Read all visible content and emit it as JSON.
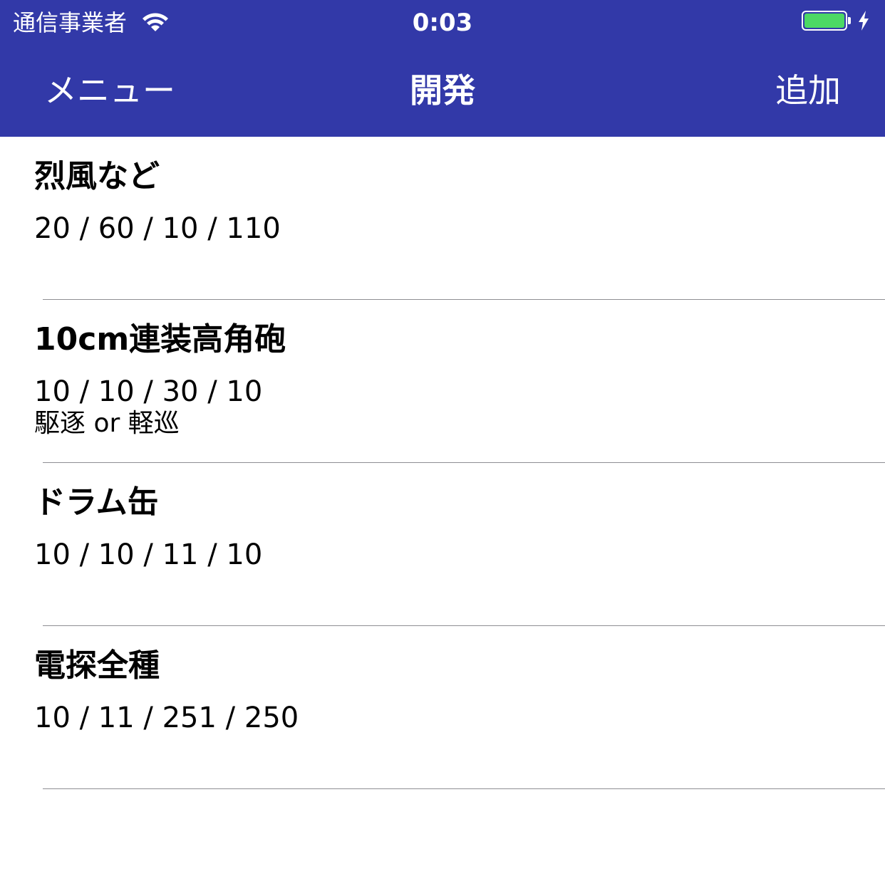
{
  "status_bar": {
    "carrier": "通信事業者",
    "time": "0:03",
    "wifi_icon": "wifi-icon",
    "battery_icon": "battery-icon",
    "charging_icon": "charging-bolt-icon",
    "battery_level": 1.0,
    "battery_color": "#4cd964"
  },
  "navbar": {
    "left_label": "メニュー",
    "title": "開発",
    "right_label": "追加",
    "background_color": "#3239a8"
  },
  "items": [
    {
      "title": "烈風など",
      "recipe": "20 / 60 / 10 / 110",
      "note": ""
    },
    {
      "title": "10cm連装高角砲",
      "recipe": "10 / 10 / 30 / 10",
      "note": "駆逐 or 軽巡"
    },
    {
      "title": "ドラム缶",
      "recipe": "10 / 10 / 11 / 10",
      "note": ""
    },
    {
      "title": "電探全種",
      "recipe": "10 / 11 / 251 / 250",
      "note": ""
    }
  ]
}
